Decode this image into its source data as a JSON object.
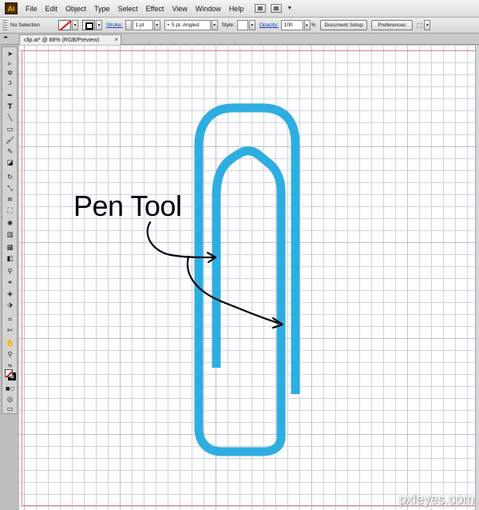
{
  "menubar": {
    "logo": "Ai",
    "items": [
      "File",
      "Edit",
      "Object",
      "Type",
      "Select",
      "Effect",
      "View",
      "Window",
      "Help"
    ]
  },
  "controlbar": {
    "selection": "No Selection",
    "stroke_label": "Stroke:",
    "stroke_weight": "1 pt",
    "brush": "5 pt. Angled",
    "style_label": "Style:",
    "opacity_label": "Opacity:",
    "opacity_value": "100",
    "opacity_unit": "%",
    "document_setup": "Document Setup",
    "preferences": "Preferences"
  },
  "document": {
    "tab_title": "clip.ai* @ 88% (RGB/Preview)",
    "close": "×"
  },
  "canvas": {
    "annotation": "Pen Tool",
    "paperclip_color": "#2eaee0",
    "watermark": "pxleyes.com"
  }
}
